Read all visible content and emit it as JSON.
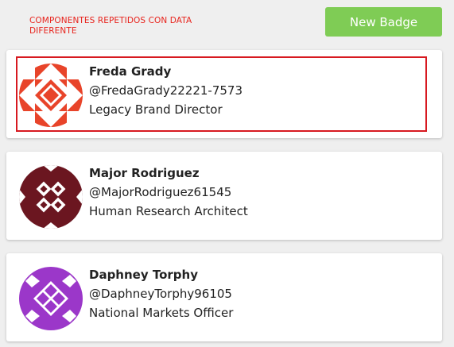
{
  "annotation": "COMPONENTES REPETIDOS CON DATA DIFERENTE",
  "toolbar": {
    "new_badge_label": "New Badge",
    "new_badge_color": "#7fcc55"
  },
  "highlight_color": "#d71920",
  "cards": [
    {
      "name": "Freda Grady",
      "handle": "@FredaGrady22221-7573",
      "title": "Legacy Brand Director",
      "avatar_icon": "identicon-avatar",
      "avatar_color": "#e8442a",
      "highlighted": true
    },
    {
      "name": "Major Rodriguez",
      "handle": "@MajorRodriguez61545",
      "title": "Human Research Architect",
      "avatar_icon": "identicon-avatar",
      "avatar_color": "#6b1620",
      "highlighted": false
    },
    {
      "name": "Daphney Torphy",
      "handle": "@DaphneyTorphy96105",
      "title": "National Markets Officer",
      "avatar_icon": "identicon-avatar",
      "avatar_color": "#9b37c9",
      "highlighted": false
    }
  ]
}
